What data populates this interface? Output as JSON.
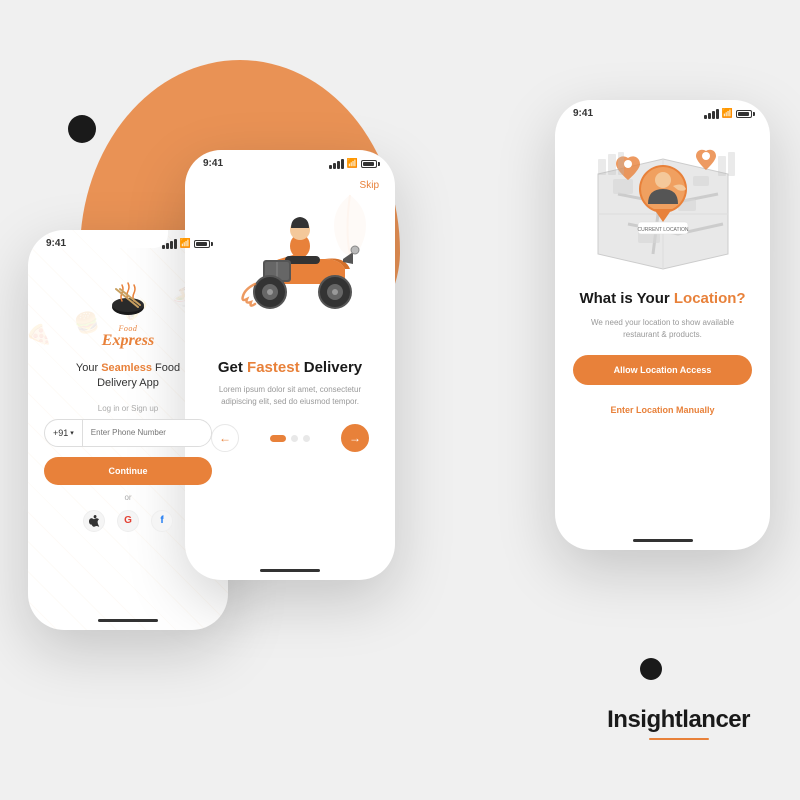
{
  "background": {
    "circle_color": "#e8813a",
    "dot_left_color": "#1a1a1a",
    "dot_right_color": "#1a1a1a"
  },
  "phone1": {
    "status_time": "9:41",
    "logo_name": "Food Express",
    "tagline_part1": "Your ",
    "tagline_highlight": "Seamless",
    "tagline_part2": " Food\nDelivery App",
    "login_label": "Log in or Sign up",
    "country_code": "+91",
    "phone_placeholder": "Enter Phone Number",
    "continue_label": "Continue",
    "or_label": "or",
    "apple_label": "",
    "google_label": "G",
    "facebook_label": "f"
  },
  "phone2": {
    "status_time": "9:41",
    "skip_label": "Skip",
    "title_part1": "Get ",
    "title_highlight": "Fastest",
    "title_part2": " Delivery",
    "description": "Lorem ipsum dolor sit amet, consectetur adipiscing elit, sed do eiusmod tempor.",
    "prev_btn": "←",
    "next_btn": "→"
  },
  "phone3": {
    "status_time": "9:41",
    "title_part1": "What is Your ",
    "title_highlight": "Location?",
    "description": "We need your location to show available restaurant & products.",
    "allow_btn_label": "Allow Location Access",
    "manual_btn_label": "Enter Location Manually",
    "current_location_label": "CURRENT LOCATION"
  },
  "brand": {
    "name": "Insightlancer"
  }
}
